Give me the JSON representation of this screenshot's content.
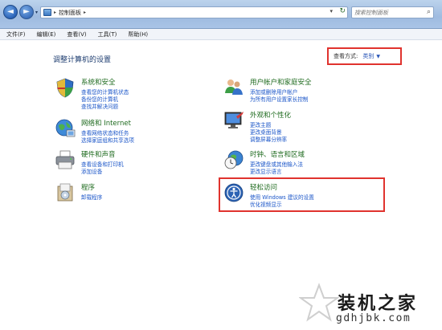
{
  "address": {
    "breadcrumb": "控制面板"
  },
  "search": {
    "placeholder": "搜索控制面板"
  },
  "menu": [
    "文件(F)",
    "编辑(E)",
    "查看(V)",
    "工具(T)",
    "帮助(H)"
  ],
  "main": {
    "title": "调整计算机的设置",
    "view_by_label": "查看方式:",
    "view_by_value": "类别"
  },
  "categories": [
    {
      "title": "系统和安全",
      "icon": "shield-icon",
      "links": [
        "查看您的计算机状态",
        "备份您的计算机",
        "查找并解决问题"
      ]
    },
    {
      "title": "网络和 Internet",
      "icon": "network-icon",
      "links": [
        "查看网络状态和任务",
        "选择家庭组和共享选项"
      ]
    },
    {
      "title": "硬件和声音",
      "icon": "printer-icon",
      "links": [
        "查看设备和打印机",
        "添加设备"
      ]
    },
    {
      "title": "程序",
      "icon": "programs-icon",
      "links": [
        "卸载程序"
      ]
    },
    {
      "title": "用户帐户和家庭安全",
      "icon": "users-icon",
      "links": [
        "添加或删除用户帐户",
        "为所有用户设置家长控制"
      ]
    },
    {
      "title": "外观和个性化",
      "icon": "monitor-icon",
      "links": [
        "更改主题",
        "更改桌面背景",
        "调整屏幕分辨率"
      ]
    },
    {
      "title": "时钟、语言和区域",
      "icon": "clock-globe-icon",
      "links": [
        "更改键盘或其他输入法",
        "更改显示语言"
      ]
    },
    {
      "title": "轻松访问",
      "icon": "ease-of-access-icon",
      "links": [
        "使用 Windows 建议的设置",
        "优化视频显示"
      ]
    }
  ],
  "watermark": {
    "name": "装机之家",
    "url": "gdhjbk.com"
  }
}
